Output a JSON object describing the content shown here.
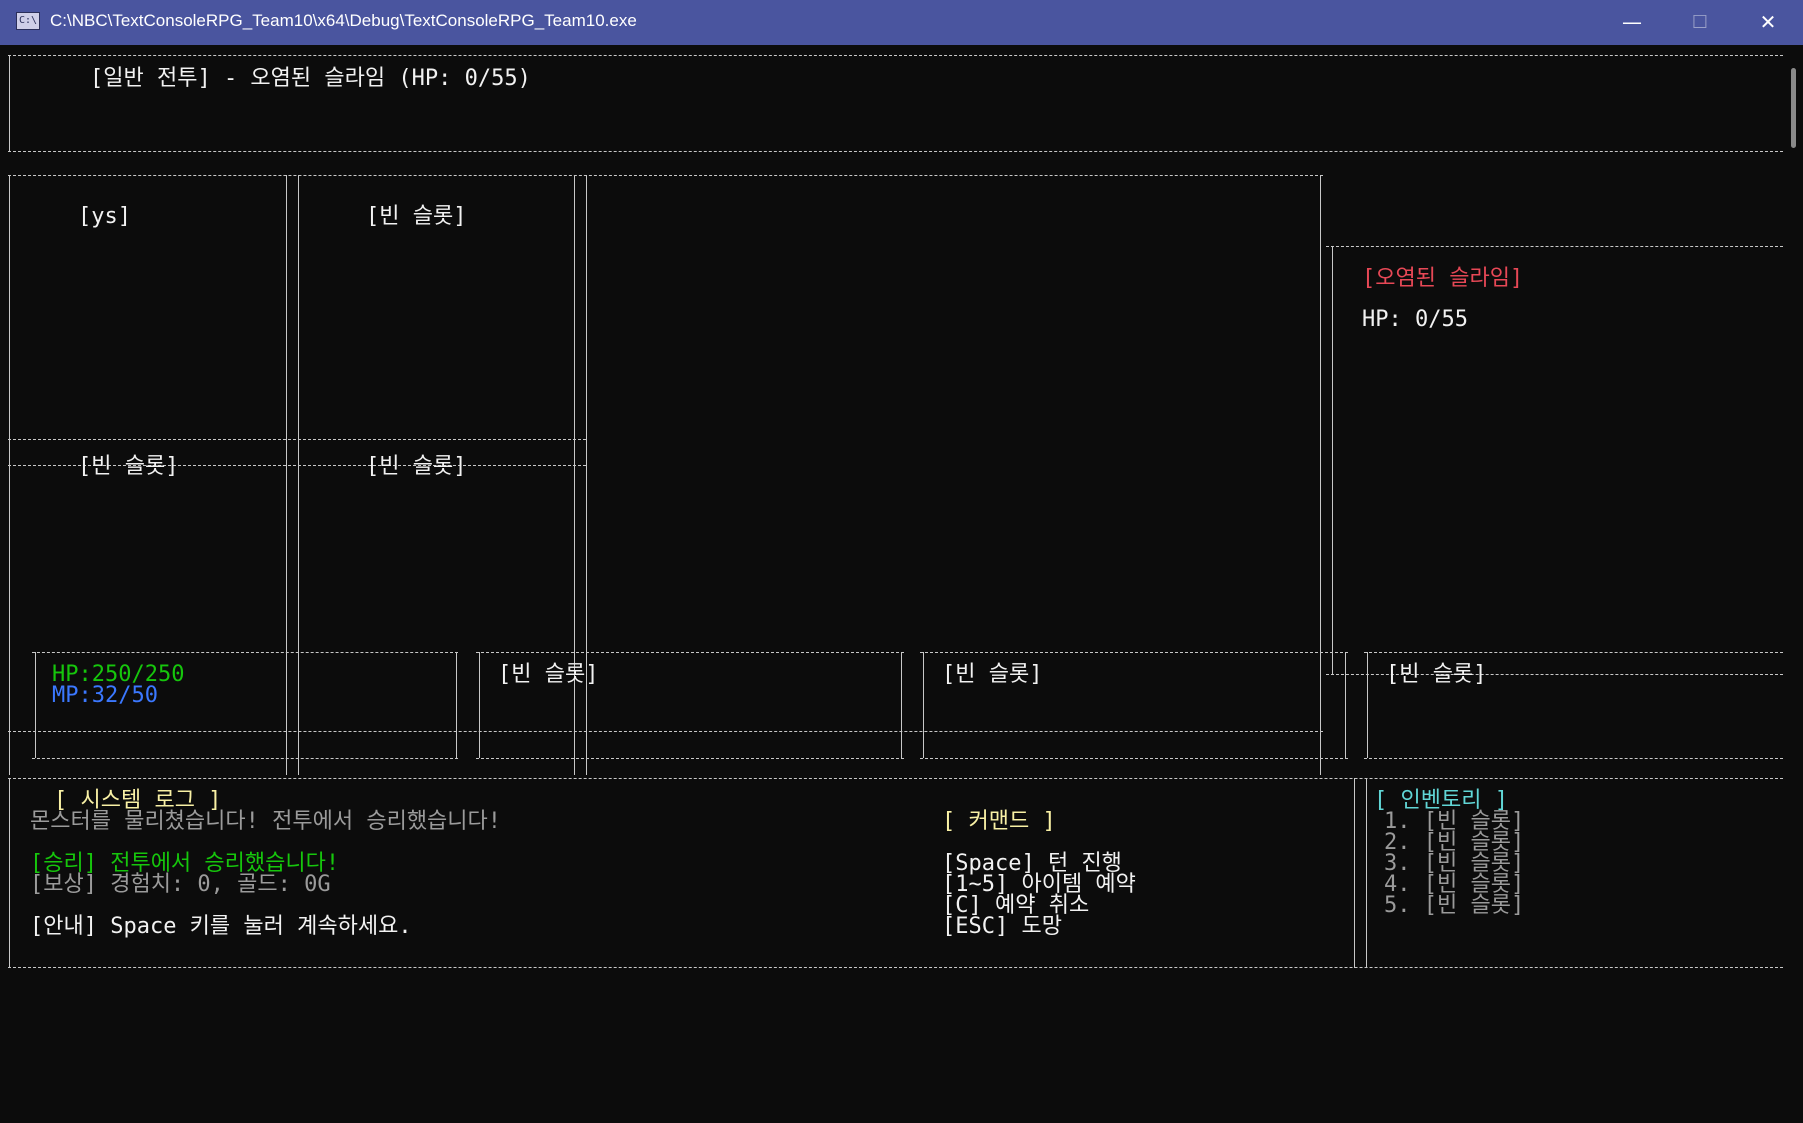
{
  "window": {
    "title": "C:\\NBC\\TextConsoleRPG_Team10\\x64\\Debug\\TextConsoleRPG_Team10.exe",
    "icon_label": "C:\\",
    "minimize": "—",
    "maximize": "☐",
    "close": "✕"
  },
  "header": {
    "title": "[일반 전투] - 오염된 슬라임 (HP: 0/55)"
  },
  "party_grid": {
    "slots": [
      "[ys]",
      "[빈 슬롯]",
      "[빈 슬롯]",
      "[빈 슬롯]"
    ]
  },
  "enemy_panel": {
    "name": "[오염된 슬라임]",
    "hp": "HP: 0/55"
  },
  "status_bar": {
    "hp": "HP:250/250",
    "mp": "MP:32/50",
    "slots": [
      "[빈 슬롯]",
      "[빈 슬롯]",
      "[빈 슬롯]"
    ]
  },
  "system_log": {
    "title": "[ 시스템 로그 ]",
    "lines": [
      "몬스터를 물리쳤습니다! 전투에서 승리했습니다!",
      "[승리] 전투에서 승리했습니다!",
      "[보상] 경험치: 0, 골드: 0G",
      "[안내] Space 키를 눌러 계속하세요."
    ]
  },
  "commands": {
    "title": "[ 커맨드 ]",
    "items": [
      "[Space] 턴 진행",
      "[1~5] 아이템 예약",
      "[C] 예약 취소",
      "[ESC] 도망"
    ]
  },
  "inventory": {
    "title": "[ 인벤토리 ]",
    "items": [
      "1. [빈 슬롯]",
      "2. [빈 슬롯]",
      "3. [빈 슬롯]",
      "4. [빈 슬롯]",
      "5. [빈 슬롯]"
    ]
  },
  "colors": {
    "hp": "#16c60c",
    "mp": "#3b78ff",
    "title": "#f9f1a5",
    "enemy": "#e74856",
    "inventory": "#61d6d6",
    "titlebar": "#4a559f"
  }
}
